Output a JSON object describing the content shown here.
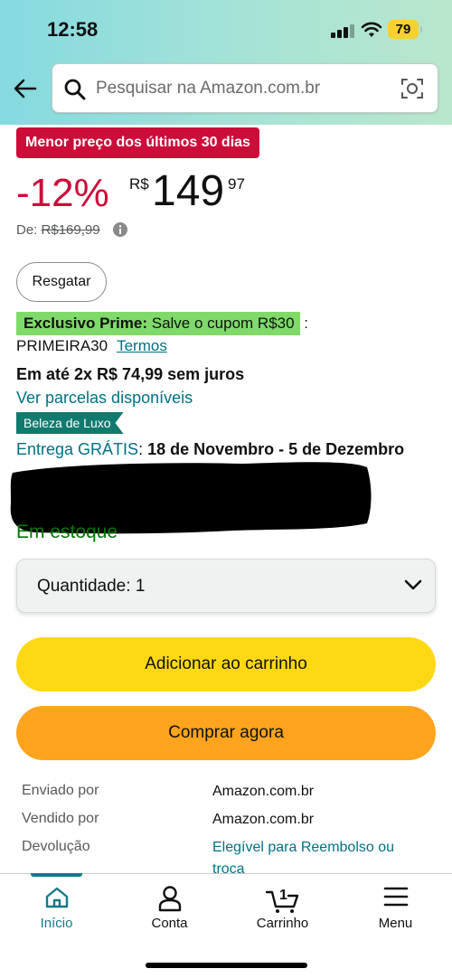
{
  "status_bar": {
    "time": "12:58",
    "battery": "79"
  },
  "search": {
    "placeholder": "Pesquisar na Amazon.com.br"
  },
  "product": {
    "deal_badge": "Menor preço dos últimos 30 dias",
    "discount": "-12%",
    "currency": "R$",
    "price_whole": "149",
    "price_fraction": "97",
    "list_price_prefix": "De:",
    "list_price": "R$169,99",
    "redeem_label": "Resgatar",
    "prime_bold": "Exclusivo Prime:",
    "prime_text": " Salve o cupom R$30",
    "prime_colon": " :",
    "coupon_code": "PRIMEIRA30",
    "terms_link": "Termos",
    "installments": "Em até 2x R$ 74,99 sem juros",
    "installments_link": "Ver parcelas disponíveis",
    "luxury_badge": "Beleza de Luxo",
    "delivery_link": "Entrega GRÁTIS",
    "delivery_colon": ": ",
    "delivery_dates": "18 de Novembro - 5 de Dezembro",
    "stock": "Em estoque"
  },
  "quantity": {
    "label": "Quantidade:",
    "value": "1"
  },
  "actions": {
    "add_to_cart": "Adicionar ao carrinho",
    "buy_now": "Comprar agora"
  },
  "details": [
    {
      "label": "Enviado por",
      "value": "Amazon.com.br"
    },
    {
      "label": "Vendido por",
      "value": "Amazon.com.br"
    },
    {
      "label": "Devolução",
      "value": "Elegível para Reembolso ou troca"
    }
  ],
  "bottom_nav": {
    "home": "Início",
    "account": "Conta",
    "cart": "Carrinho",
    "cart_count": "1",
    "menu": "Menu"
  },
  "colors": {
    "deal_red": "#cc0c39",
    "link_teal": "#007185",
    "prime_green": "#7fda69",
    "add_to_cart_yellow": "#ffd814",
    "buy_now_orange": "#ffa41c",
    "stock_green": "#007600"
  }
}
